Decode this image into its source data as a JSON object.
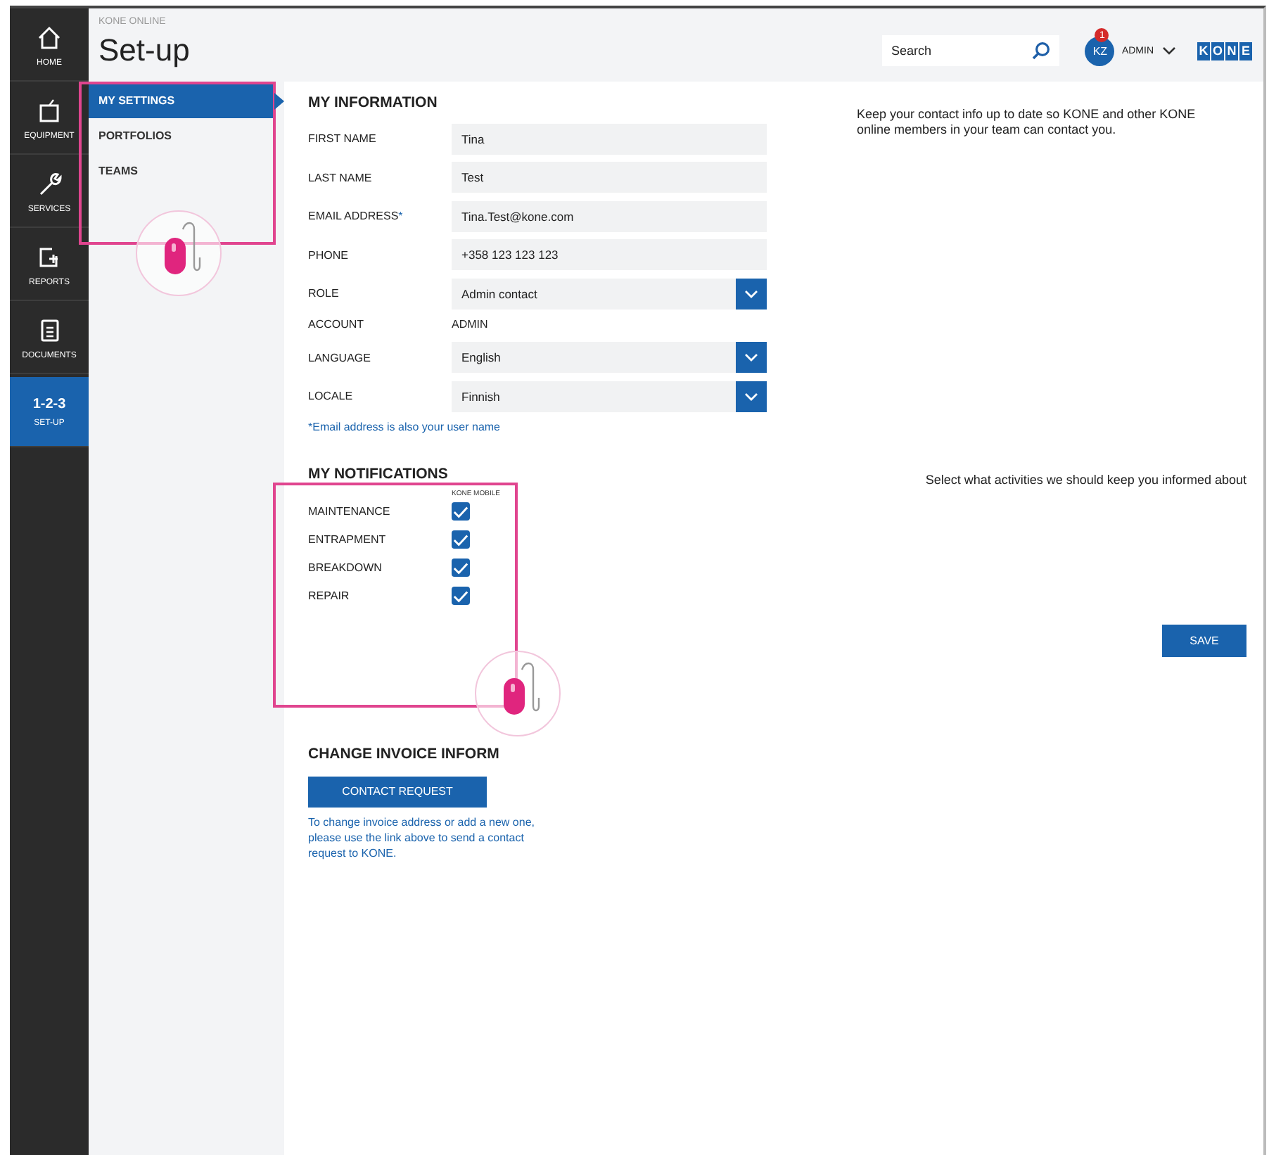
{
  "app": {
    "breadcrumb": "KONE ONLINE",
    "title": "Set-up"
  },
  "header": {
    "search": {
      "placeholder": "Search"
    },
    "user": {
      "initials": "KZ",
      "badge": "1",
      "name": "ADMIN"
    },
    "logo": [
      "K",
      "O",
      "N",
      "E"
    ]
  },
  "nav": [
    {
      "kind": "home",
      "label": "HOME",
      "selected": false
    },
    {
      "kind": "equipment",
      "label": "EQUIPMENT",
      "selected": false
    },
    {
      "kind": "services",
      "label": "SERVICES",
      "selected": false
    },
    {
      "kind": "reports",
      "label": "REPORTS",
      "selected": false
    },
    {
      "kind": "documents",
      "label": "DOCUMENTS",
      "selected": false
    },
    {
      "kind": "steps",
      "icon_text": "1-2-3",
      "label": "SET-UP",
      "selected": true
    }
  ],
  "subnav": [
    {
      "label": "MY SETTINGS",
      "selected": true
    },
    {
      "label": "PORTFOLIOS",
      "selected": false
    },
    {
      "label": "TEAMS",
      "selected": false
    }
  ],
  "my_information": {
    "heading": "MY INFORMATION",
    "description": "Keep your contact info up to date so KONE and other KONE online members in your team can contact you.",
    "fields": [
      {
        "kind": "text",
        "label": "FIRST NAME",
        "value": "Tina"
      },
      {
        "kind": "text",
        "label": "LAST NAME",
        "value": "Test"
      },
      {
        "kind": "text",
        "label": "EMAIL ADDRESS",
        "mark": "*",
        "value": "Tina.Test@kone.com"
      },
      {
        "kind": "text",
        "label": "PHONE",
        "value": "+358 123 123 123"
      },
      {
        "kind": "select",
        "label": "ROLE",
        "value": "Admin contact"
      },
      {
        "kind": "static",
        "label": "ACCOUNT",
        "value": "ADMIN"
      },
      {
        "kind": "select",
        "label": "LANGUAGE",
        "value": "English"
      },
      {
        "kind": "select",
        "label": "LOCALE",
        "value": "Finnish"
      }
    ],
    "footnote": "*Email address is also your user name"
  },
  "my_notifications": {
    "heading": "MY NOTIFICATIONS",
    "description": "Select what activities we should keep you informed about",
    "column": "KONE MOBILE",
    "items": [
      {
        "label": "MAINTENANCE",
        "checked": true
      },
      {
        "label": "ENTRAPMENT",
        "checked": true
      },
      {
        "label": "BREAKDOWN",
        "checked": true
      },
      {
        "label": "REPAIR",
        "checked": true
      }
    ],
    "save": "SAVE"
  },
  "invoice": {
    "heading": "CHANGE INVOICE INFORM",
    "button": "CONTACT REQUEST",
    "note": "To change invoice address or add a new one, please use the link above to send a contact request to KONE."
  }
}
